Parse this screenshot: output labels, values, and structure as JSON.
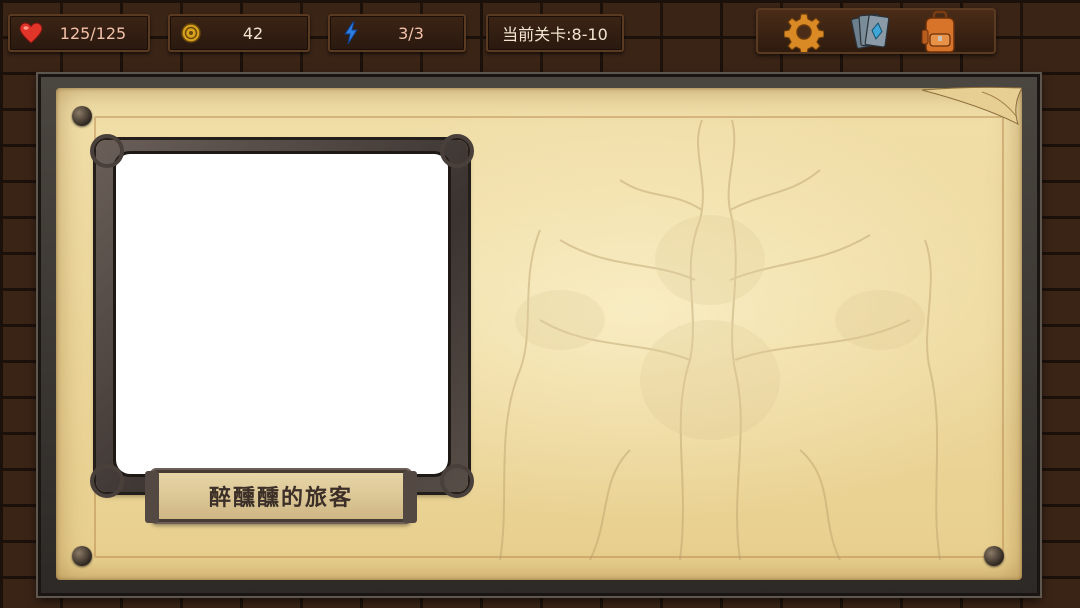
{
  "hud": {
    "health": {
      "value": "125/125",
      "icon": "heart-icon",
      "color": "#e2352a"
    },
    "coins": {
      "value": "42",
      "icon": "coin-icon",
      "color": "#d9a21f"
    },
    "energy": {
      "value": "3/3",
      "icon": "lightning-icon",
      "color": "#2f7de0"
    },
    "stage": {
      "label": "当前关卡:8-10"
    }
  },
  "toolbar": {
    "settings": {
      "icon": "gear-icon",
      "color": "#d98a24"
    },
    "cards": {
      "icon": "card-deck-icon",
      "color": "#3fa6d8"
    },
    "backpack": {
      "icon": "backpack-icon",
      "color": "#d8742a"
    }
  },
  "encounter": {
    "character_name": "醉醺醺的旅客"
  }
}
